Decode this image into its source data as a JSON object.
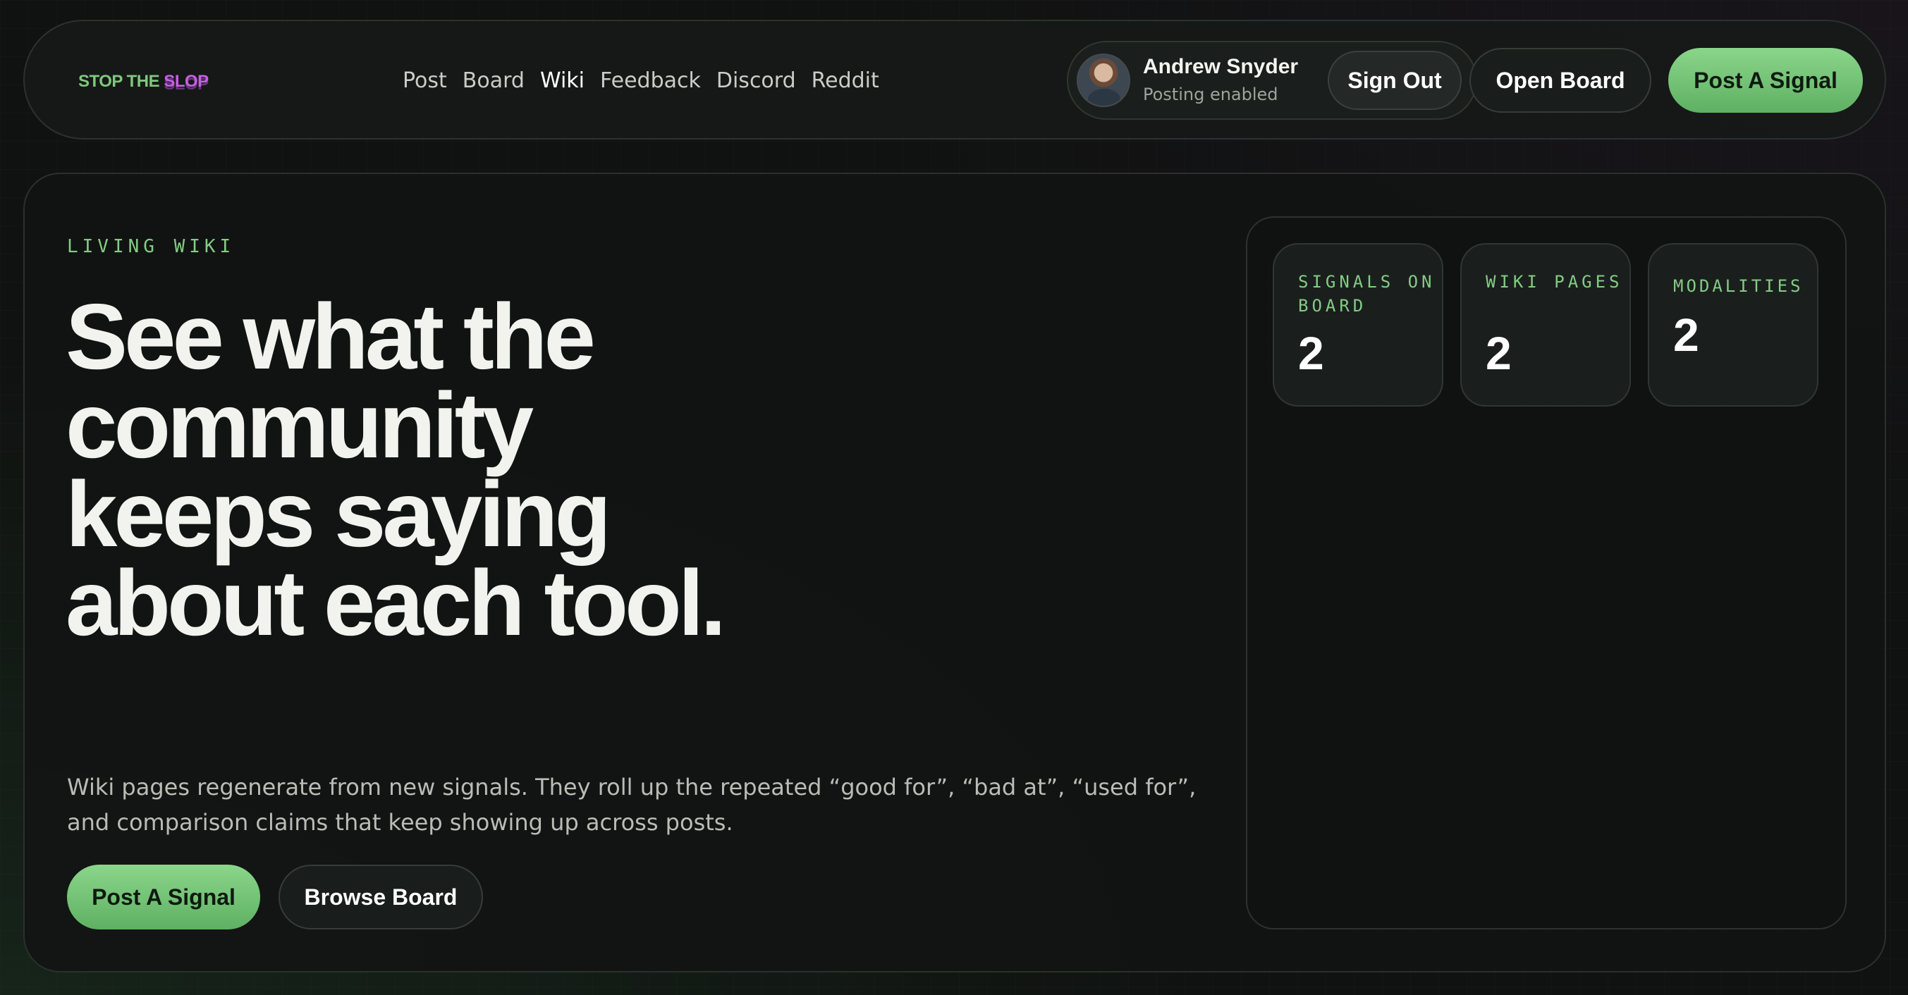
{
  "nav": {
    "logo": {
      "part1": "STOP THE ",
      "part2": "SLOP"
    },
    "links": [
      "Post",
      "Board",
      "Wiki",
      "Feedback",
      "Discord",
      "Reddit"
    ],
    "active_link": "Wiki",
    "user": {
      "name": "Andrew Snyder",
      "status": "Posting enabled",
      "sign_out_label": "Sign Out"
    },
    "open_board_label": "Open Board",
    "post_signal_label": "Post A Signal"
  },
  "hero": {
    "eyebrow": "LIVING WIKI",
    "headline": "See what the community keeps saying about each tool.",
    "description": "Wiki pages regenerate from new signals. They roll up the repeated “good for”, “bad at”, “used for”, and comparison claims that keep showing up across posts.",
    "primary_button": "Post A Signal",
    "secondary_button": "Browse Board"
  },
  "stats": [
    {
      "label": "SIGNALS ON BOARD",
      "value": "2"
    },
    {
      "label": "WIKI PAGES",
      "value": "2"
    },
    {
      "label": "MODALITIES",
      "value": "2"
    }
  ],
  "colors": {
    "accent_green": "#84cc84",
    "logo_purple": "#c85ee8",
    "background": "#101211"
  }
}
